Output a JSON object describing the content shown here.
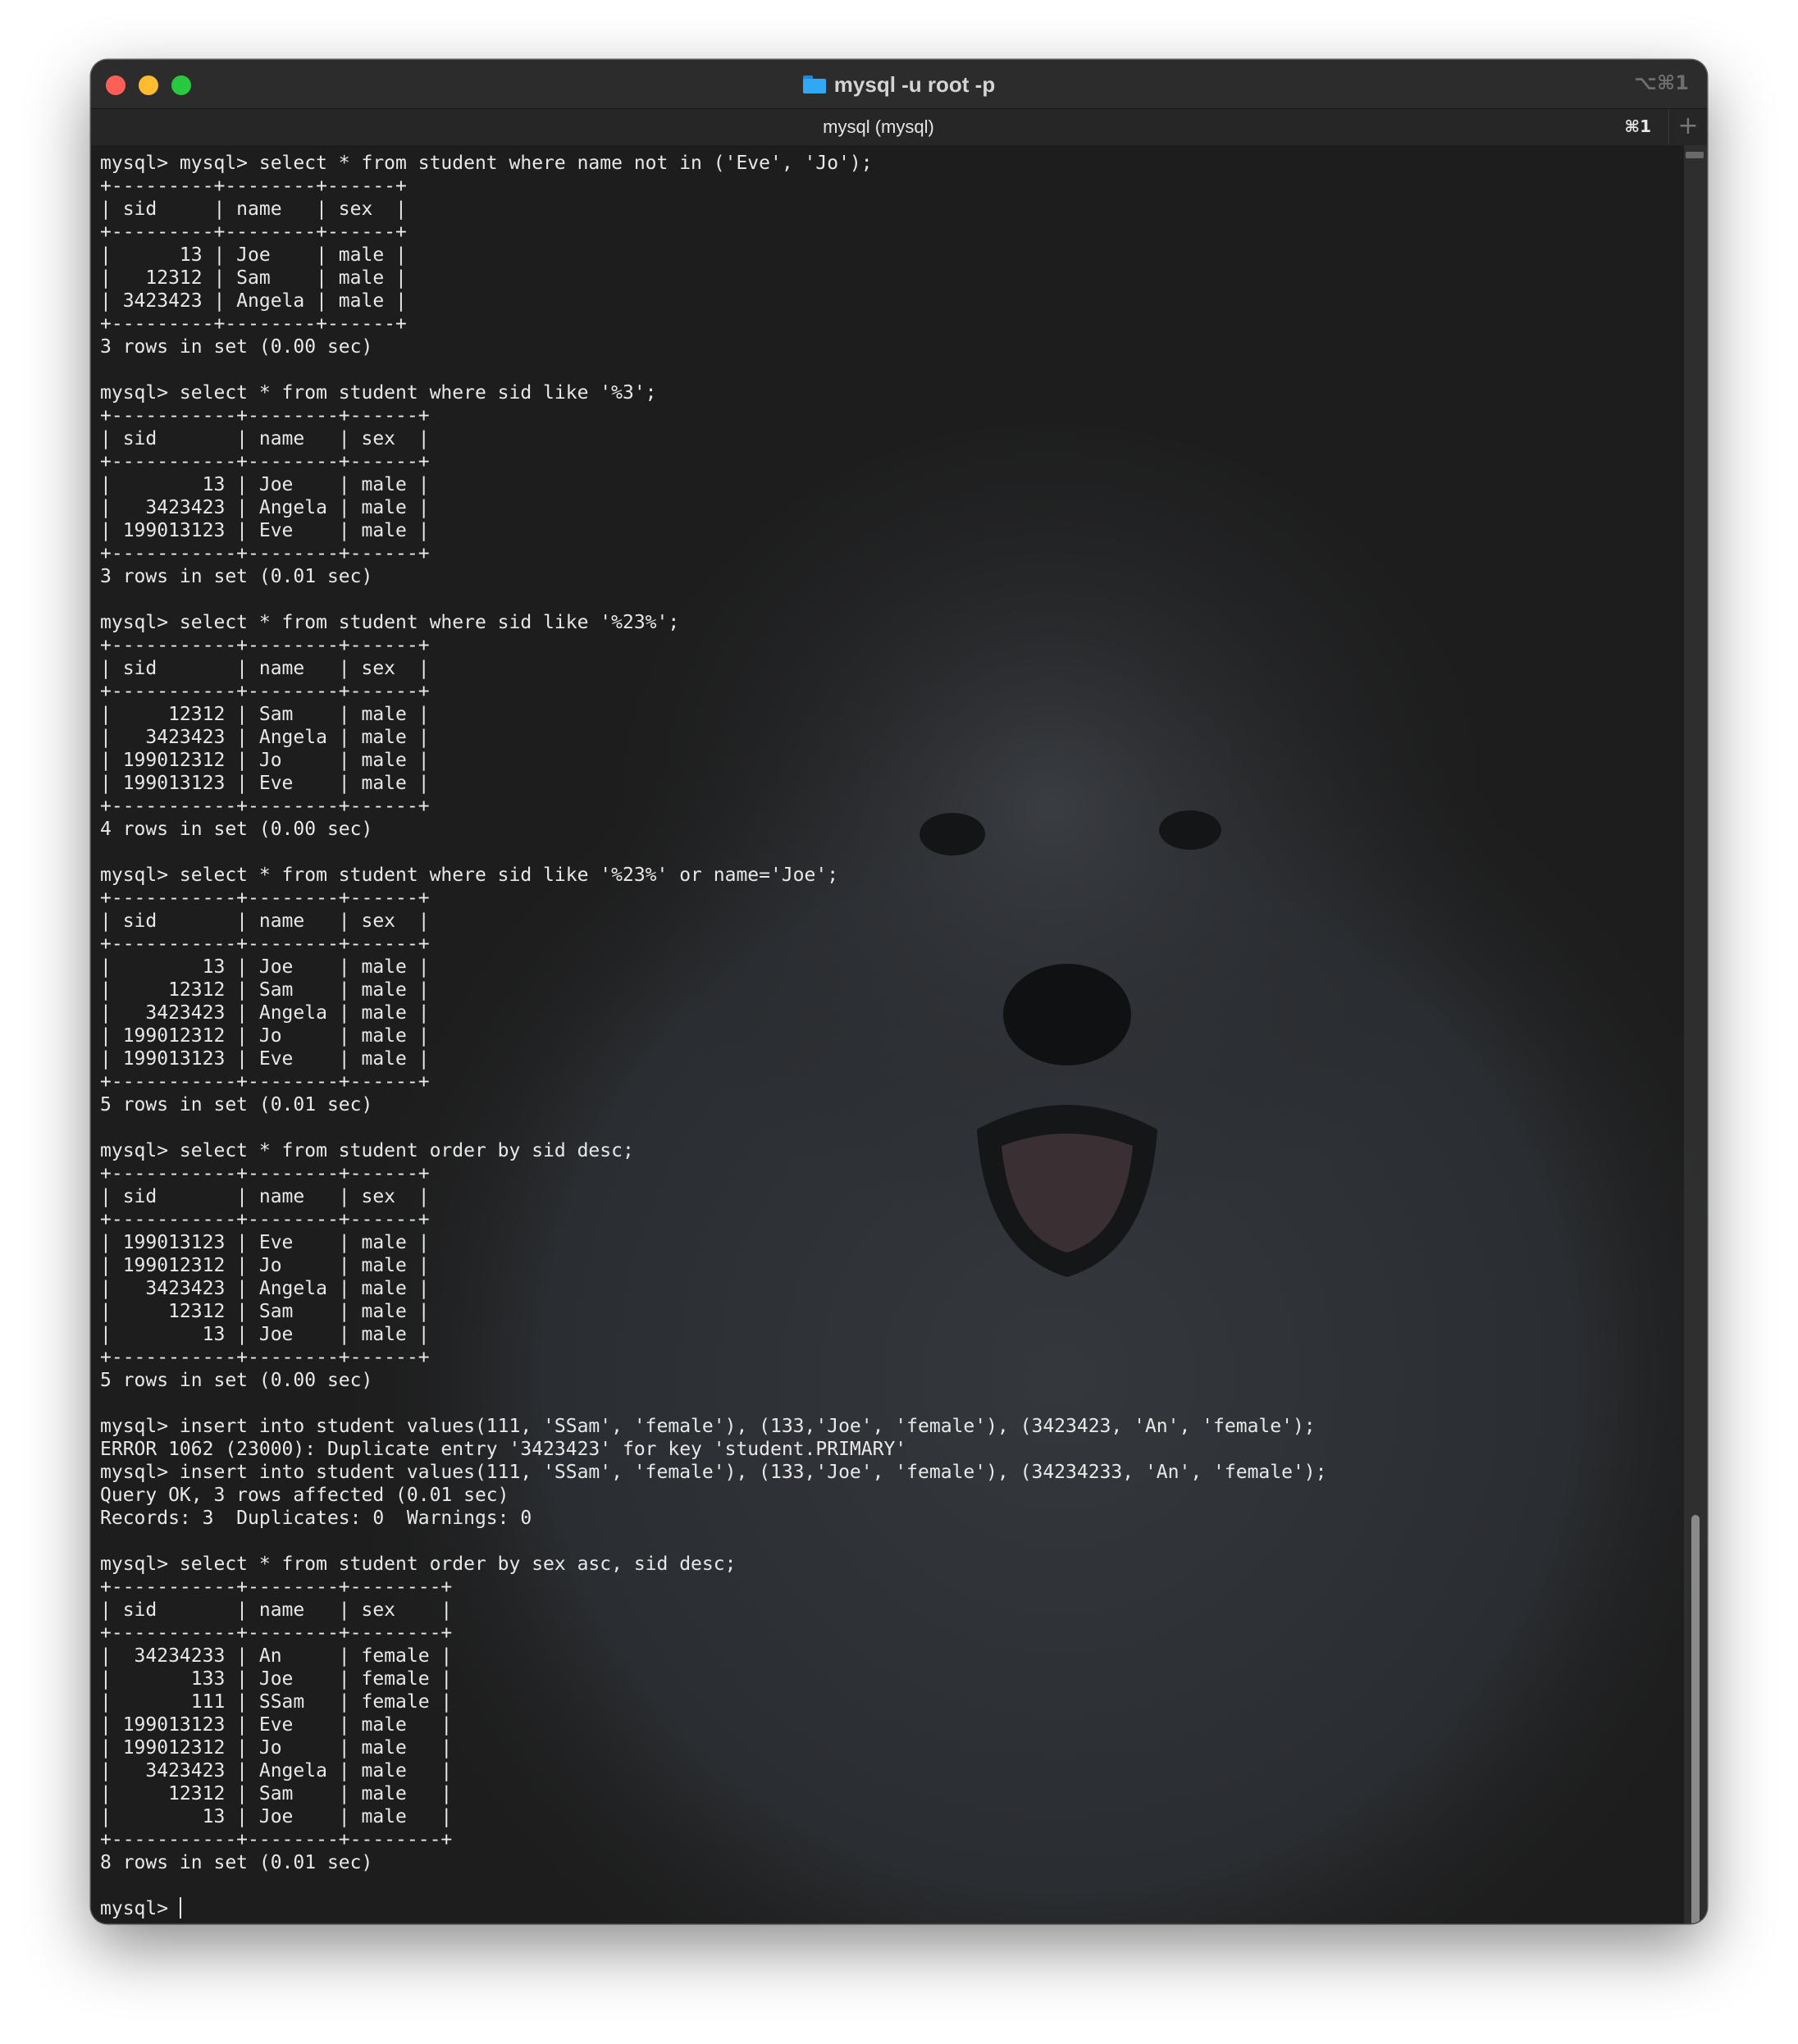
{
  "window": {
    "title": "mysql -u root -p",
    "title_shortcut": "⌥⌘1",
    "folder_icon": "folder-icon"
  },
  "tabs": [
    {
      "label": "mysql (mysql)",
      "shortcut": "⌘1"
    }
  ],
  "new_tab_label": "+",
  "terminal": {
    "lines": [
      "mysql> mysql> select * from student where name not in ('Eve', 'Jo');",
      "+---------+--------+------+",
      "| sid     | name   | sex  |",
      "+---------+--------+------+",
      "|      13 | Joe    | male |",
      "|   12312 | Sam    | male |",
      "| 3423423 | Angela | male |",
      "+---------+--------+------+",
      "3 rows in set (0.00 sec)",
      "",
      "mysql> select * from student where sid like '%3';",
      "+-----------+--------+------+",
      "| sid       | name   | sex  |",
      "+-----------+--------+------+",
      "|        13 | Joe    | male |",
      "|   3423423 | Angela | male |",
      "| 199013123 | Eve    | male |",
      "+-----------+--------+------+",
      "3 rows in set (0.01 sec)",
      "",
      "mysql> select * from student where sid like '%23%';",
      "+-----------+--------+------+",
      "| sid       | name   | sex  |",
      "+-----------+--------+------+",
      "|     12312 | Sam    | male |",
      "|   3423423 | Angela | male |",
      "| 199012312 | Jo     | male |",
      "| 199013123 | Eve    | male |",
      "+-----------+--------+------+",
      "4 rows in set (0.00 sec)",
      "",
      "mysql> select * from student where sid like '%23%' or name='Joe';",
      "+-----------+--------+------+",
      "| sid       | name   | sex  |",
      "+-----------+--------+------+",
      "|        13 | Joe    | male |",
      "|     12312 | Sam    | male |",
      "|   3423423 | Angela | male |",
      "| 199012312 | Jo     | male |",
      "| 199013123 | Eve    | male |",
      "+-----------+--------+------+",
      "5 rows in set (0.01 sec)",
      "",
      "mysql> select * from student order by sid desc;",
      "+-----------+--------+------+",
      "| sid       | name   | sex  |",
      "+-----------+--------+------+",
      "| 199013123 | Eve    | male |",
      "| 199012312 | Jo     | male |",
      "|   3423423 | Angela | male |",
      "|     12312 | Sam    | male |",
      "|        13 | Joe    | male |",
      "+-----------+--------+------+",
      "5 rows in set (0.00 sec)",
      "",
      "mysql> insert into student values(111, 'SSam', 'female'), (133,'Joe', 'female'), (3423423, 'An', 'female');",
      "ERROR 1062 (23000): Duplicate entry '3423423' for key 'student.PRIMARY'",
      "mysql> insert into student values(111, 'SSam', 'female'), (133,'Joe', 'female'), (34234233, 'An', 'female');",
      "Query OK, 3 rows affected (0.01 sec)",
      "Records: 3  Duplicates: 0  Warnings: 0",
      "",
      "mysql> select * from student order by sex asc, sid desc;",
      "+-----------+--------+--------+",
      "| sid       | name   | sex    |",
      "+-----------+--------+--------+",
      "|  34234233 | An     | female |",
      "|       133 | Joe    | female |",
      "|       111 | SSam   | female |",
      "| 199013123 | Eve    | male   |",
      "| 199012312 | Jo     | male   |",
      "|   3423423 | Angela | male   |",
      "|     12312 | Sam    | male   |",
      "|        13 | Joe    | male   |",
      "+-----------+--------+--------+",
      "8 rows in set (0.01 sec)",
      ""
    ],
    "prompt": "mysql> "
  },
  "colors": {
    "background": "#1d1d1d",
    "text": "#e8e8e8",
    "close": "#ff5f57",
    "minimize": "#febc2e",
    "maximize": "#28c840"
  }
}
